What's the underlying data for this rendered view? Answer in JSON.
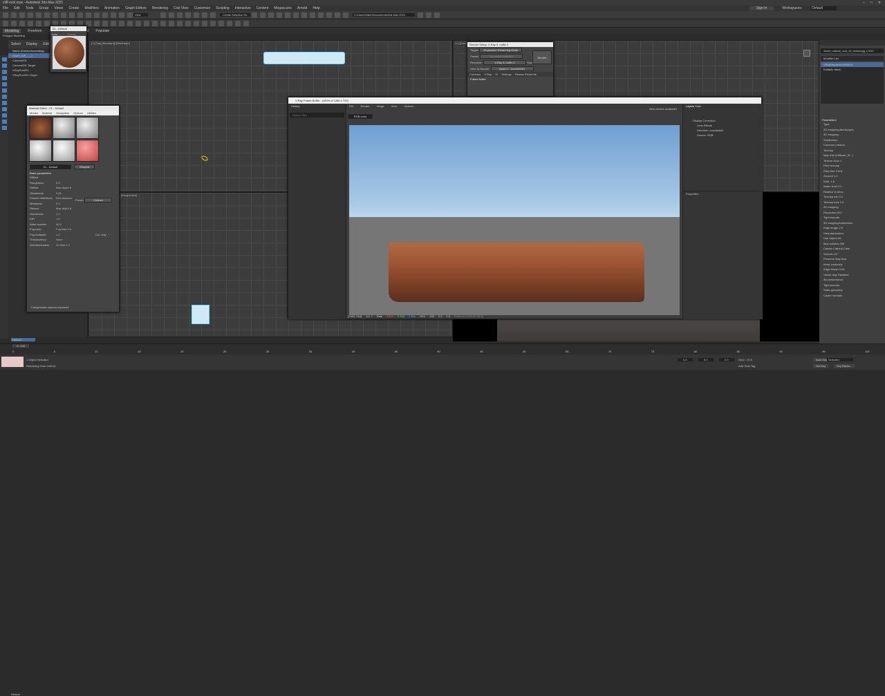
{
  "window": {
    "title": "cliff-rock.max - Autodesk 3ds Max 2021",
    "sign_in": "Sign In",
    "workspaces_label": "Workspaces:",
    "workspace": "Default"
  },
  "menu": [
    "File",
    "Edit",
    "Tools",
    "Group",
    "Views",
    "Create",
    "Modifiers",
    "Animation",
    "Graph Editors",
    "Rendering",
    "Civil View",
    "Customize",
    "Scripting",
    "Interactive",
    "Content",
    "Megascans",
    "Arnold",
    "Help"
  ],
  "toolbar": {
    "view_select": "View",
    "selection_set": "Create Selection Se",
    "project_path": "C:\\Users\\Valeri\\Documents\\3ds Max 2021"
  },
  "ribbon": {
    "tabs": [
      "Modeling",
      "Freeform",
      "Selection",
      "Object Paint",
      "Populate"
    ],
    "sub": "Polygon Modeling"
  },
  "scene_explorer": {
    "header": [
      "Select",
      "Display",
      "Edit"
    ],
    "column": "Name (Sorted Ascending)",
    "items": [
      "Asset_Cliff_..._1",
      "Camera001",
      "Camera001.Target",
      "VRaySun001",
      "VRaySun001.Target"
    ]
  },
  "viewports": {
    "top_left": "[+] [Top] [Standard] [Wireframe]",
    "top_right": "[+] [Camera001] [Standard] [Default Shading]",
    "bottom_left": "[Perspective]"
  },
  "material_editor_small": {
    "title": "01 - Default",
    "auto": "Auto",
    "update": "Update"
  },
  "material_editor": {
    "title": "Material Editor - 01 - Default",
    "menu": [
      "Modes",
      "Material",
      "Navigation",
      "Options",
      "Utilities"
    ],
    "material_name": "01 - Default",
    "material_type": "VRayMtl",
    "rollout": "Basic parameters",
    "params": [
      {
        "label": "Diffuse",
        "value": ""
      },
      {
        "label": "Roughness",
        "value": "0.0"
      },
      {
        "label": "Reflect",
        "value": "Max depth   8"
      },
      {
        "label": "Glossiness",
        "value": "0.65"
      },
      {
        "label": "Fresnel reflections",
        "value": "Dim distance"
      },
      {
        "label": "Metalness",
        "value": "0.0"
      },
      {
        "label": "Refract",
        "value": "Max depth   8"
      },
      {
        "label": "Glossiness",
        "value": "1.0"
      },
      {
        "label": "IOR",
        "value": "1.6"
      },
      {
        "label": "Abbe number",
        "value": "50.0"
      },
      {
        "label": "Fog color",
        "value": "Fog bias  0.0"
      },
      {
        "label": "Fog multiplier",
        "value": "1.0"
      },
      {
        "label": "Translucency",
        "value": "None"
      },
      {
        "label": "Self-illumination",
        "value": "GI   Mult  1.0"
      }
    ],
    "preset_label": "Preset",
    "preset_value": "Custom",
    "affect_channels": "Col. only",
    "compensate": "Compensate camera exposure"
  },
  "render_setup": {
    "title": "Render Setup: V-Ray 5, hotfix 2",
    "target_label": "Target:",
    "target": "Production Rendering Mode",
    "preset_label": "Preset:",
    "preset": "No preset selected",
    "renderer_label": "Renderer:",
    "renderer": "V-Ray 5, hotfix 2",
    "save_file": "Save File",
    "view_label": "View to Render:",
    "view": "Quad 4 - Camera001",
    "render_button": "Render",
    "tabs": [
      "Common",
      "V-Ray",
      "GI",
      "Settings",
      "Render Elements"
    ],
    "rollout": "Frame buffer"
  },
  "vfb": {
    "title": "V-Ray Frame Buffer - [100% of 1280 x 720]",
    "menu": [
      "File",
      "Render",
      "Image",
      "View",
      "Options"
    ],
    "history": "History",
    "search_placeholder": "Search files",
    "channel": "RGB color",
    "new_version": "New version available!",
    "layers_tabs": [
      "Layers",
      "Stats"
    ],
    "layers": [
      "Display Correction",
      "Lens Effects",
      "Denoiser: unavailable",
      "Source: RGB"
    ],
    "properties": "Properties",
    "status": {
      "coords": "[1063, 344]",
      "space": "1x1  ?",
      "mode": "Raw",
      "r": "0.525",
      "g": "0.725",
      "b": "0.264",
      "hsv": "HSV",
      "h": "188",
      "s": "0.3",
      "v": "0.6",
      "info": "Finished in [00:00:36.4]"
    }
  },
  "command_panel": {
    "object_name": "Asset_natural_rock_M_vwkeacgg_LOD0",
    "modifier_list": "Modifier List",
    "stack": [
      "VRayDisplacementMod",
      "Editable Mesh"
    ],
    "rollout": "Parameters",
    "items": [
      "Type",
      "2D mapping (landscape)",
      "3D mapping",
      "Subdivision",
      "Common params",
      "Texmap",
      "Map #18 (Cliffrock_Di...)",
      "Texture chan  1",
      "Filter texmap",
      "Filter blur  0.001",
      "Amount  1.0",
      "Shift  -1.0",
      "Water level  0.0",
      "Relative to bbox",
      "Texmap min  0.0",
      "Texmap max  1.0",
      "2D mapping",
      "Resolution  512",
      "Tight bounds",
      "3D mapping/subdivision",
      "Edge length  2.0",
      "View-dependent",
      "Use object mtl",
      "Max subdivs  256",
      "Classic Catmull-Clark",
      "Smooth UV",
      "Preserve Map Bnd",
      "Keep continuity",
      "Edge thresh  0.05",
      "Vector disp  Disabled",
      "3D performance",
      "Tight bounds",
      "Static geometry",
      "Cache normals"
    ]
  },
  "timeline": {
    "frame": "0 / 100",
    "ticks": [
      "0",
      "5",
      "10",
      "15",
      "20",
      "25",
      "30",
      "35",
      "40",
      "45",
      "50",
      "55",
      "60",
      "65",
      "70",
      "75",
      "80",
      "85",
      "90",
      "95",
      "100"
    ]
  },
  "status": {
    "selection": "1 Object Selected",
    "render_time": "Rendering Time  0:00:41",
    "x": "0.0",
    "y": "0.0",
    "z": "0.0",
    "grid": "Grid = 10.0",
    "auto_key": "Auto Key",
    "selected": "Selected",
    "set_key": "Set Key",
    "key_filters": "Key Filters...",
    "add_time_tag": "Add Time Tag",
    "layer": "Default"
  }
}
